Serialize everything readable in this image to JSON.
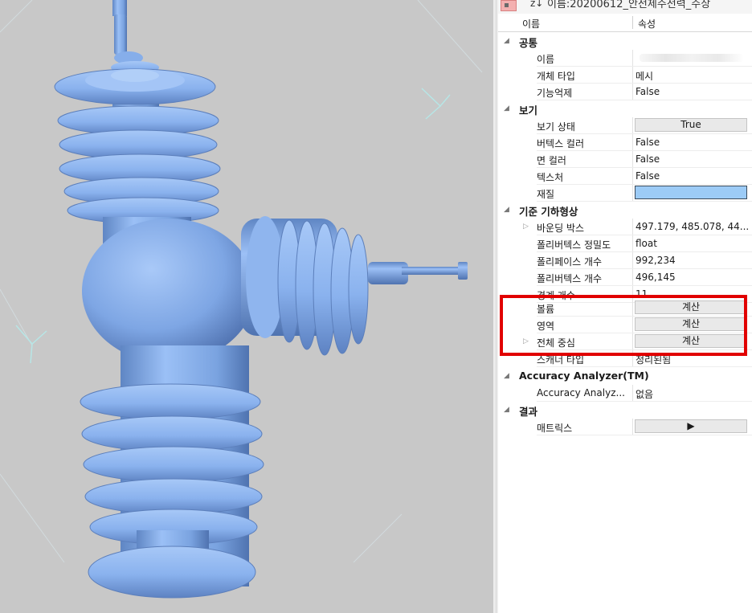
{
  "toolbar": {
    "sort_icon": "az-sort-icon",
    "title": "이름:20200612_안전제주전력_주상"
  },
  "columns": {
    "name": "이름",
    "property": "속성"
  },
  "icons": {
    "collapse": "◢",
    "expand": "▷",
    "play": "▶"
  },
  "categories": {
    "common": "공통",
    "view": "보기",
    "geometry": "기준 기하형상",
    "accuracy": "Accuracy Analyzer(TM)",
    "result": "결과"
  },
  "rows": {
    "name": {
      "label": "이름",
      "value": ""
    },
    "object_type": {
      "label": "개체 타입",
      "value": "메시"
    },
    "suppress": {
      "label": "기능억제",
      "value": "False"
    },
    "view_state": {
      "label": "보기 상태",
      "value": "True"
    },
    "vertex_color": {
      "label": "버텍스 컬러",
      "value": "False"
    },
    "face_color": {
      "label": "면 컬러",
      "value": "False"
    },
    "texture": {
      "label": "텍스처",
      "value": "False"
    },
    "material": {
      "label": "재질",
      "color": "#9ccbf6"
    },
    "bounding_box": {
      "label": "바운딩 박스",
      "value": "497.179, 485.078, 44..."
    },
    "poly_precision": {
      "label": "폴리버텍스 정밀도",
      "value": "float"
    },
    "polyface_count": {
      "label": "폴리페이스 개수",
      "value": "992,234"
    },
    "polyvertex_count": {
      "label": "폴리버텍스 개수",
      "value": "496,145"
    },
    "boundary_count": {
      "label": "경계 개수",
      "value": "11"
    },
    "volume": {
      "label": "볼륨",
      "button": "계산"
    },
    "area": {
      "label": "영역",
      "button": "계산"
    },
    "centroid": {
      "label": "전체 중심",
      "button": "계산"
    },
    "shell_type": {
      "label": "스캐너 타입",
      "value": "정리된됨"
    },
    "accuracy_analyzer": {
      "label": "Accuracy Analyz...",
      "value": "없음"
    },
    "matrix": {
      "label": "매트릭스"
    }
  },
  "colors": {
    "highlight": "#e10000",
    "model": "#8eb6f2",
    "viewport_bg": "#c8c8c8"
  }
}
